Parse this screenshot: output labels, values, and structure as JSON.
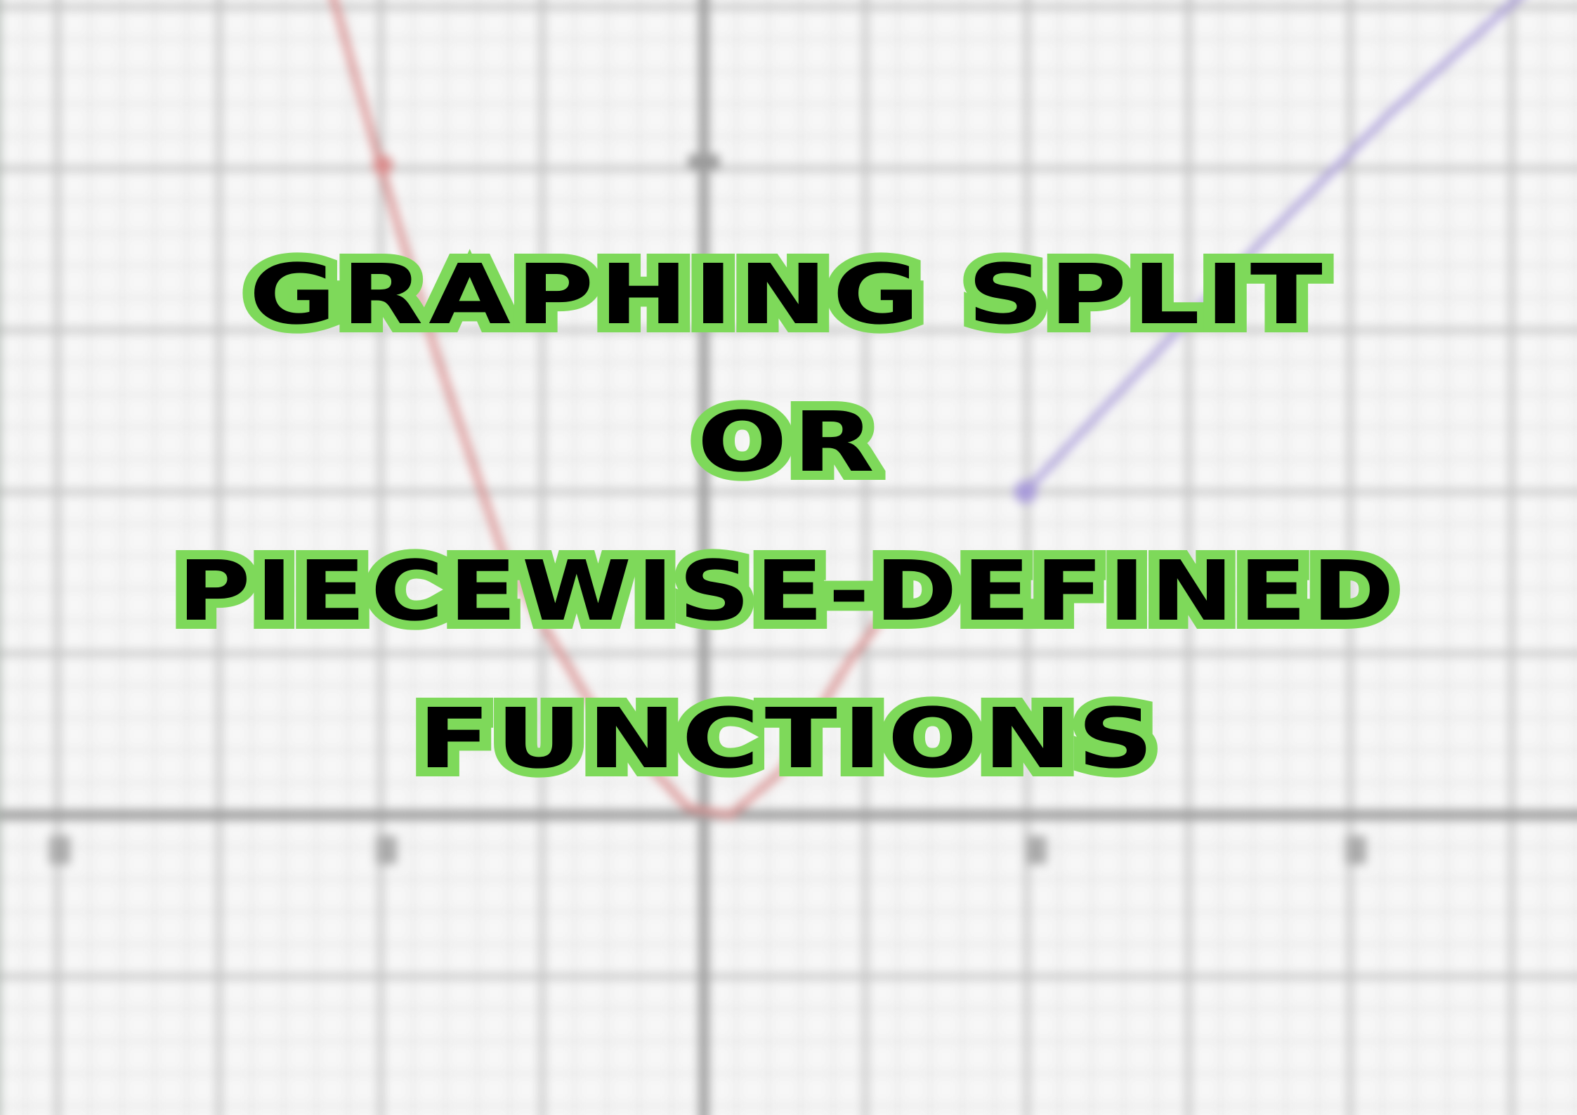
{
  "title": {
    "line1": "Graphing Split",
    "line2": "or",
    "line3": "Piecewise-Defined",
    "line4": "Functions"
  },
  "colors": {
    "outline": "#7ed95a",
    "text": "#000000",
    "background": "#f7f7f7",
    "red_curve": "#d88a8a",
    "purple_curve": "#a79ad8",
    "grid": "#c9c9c9"
  }
}
